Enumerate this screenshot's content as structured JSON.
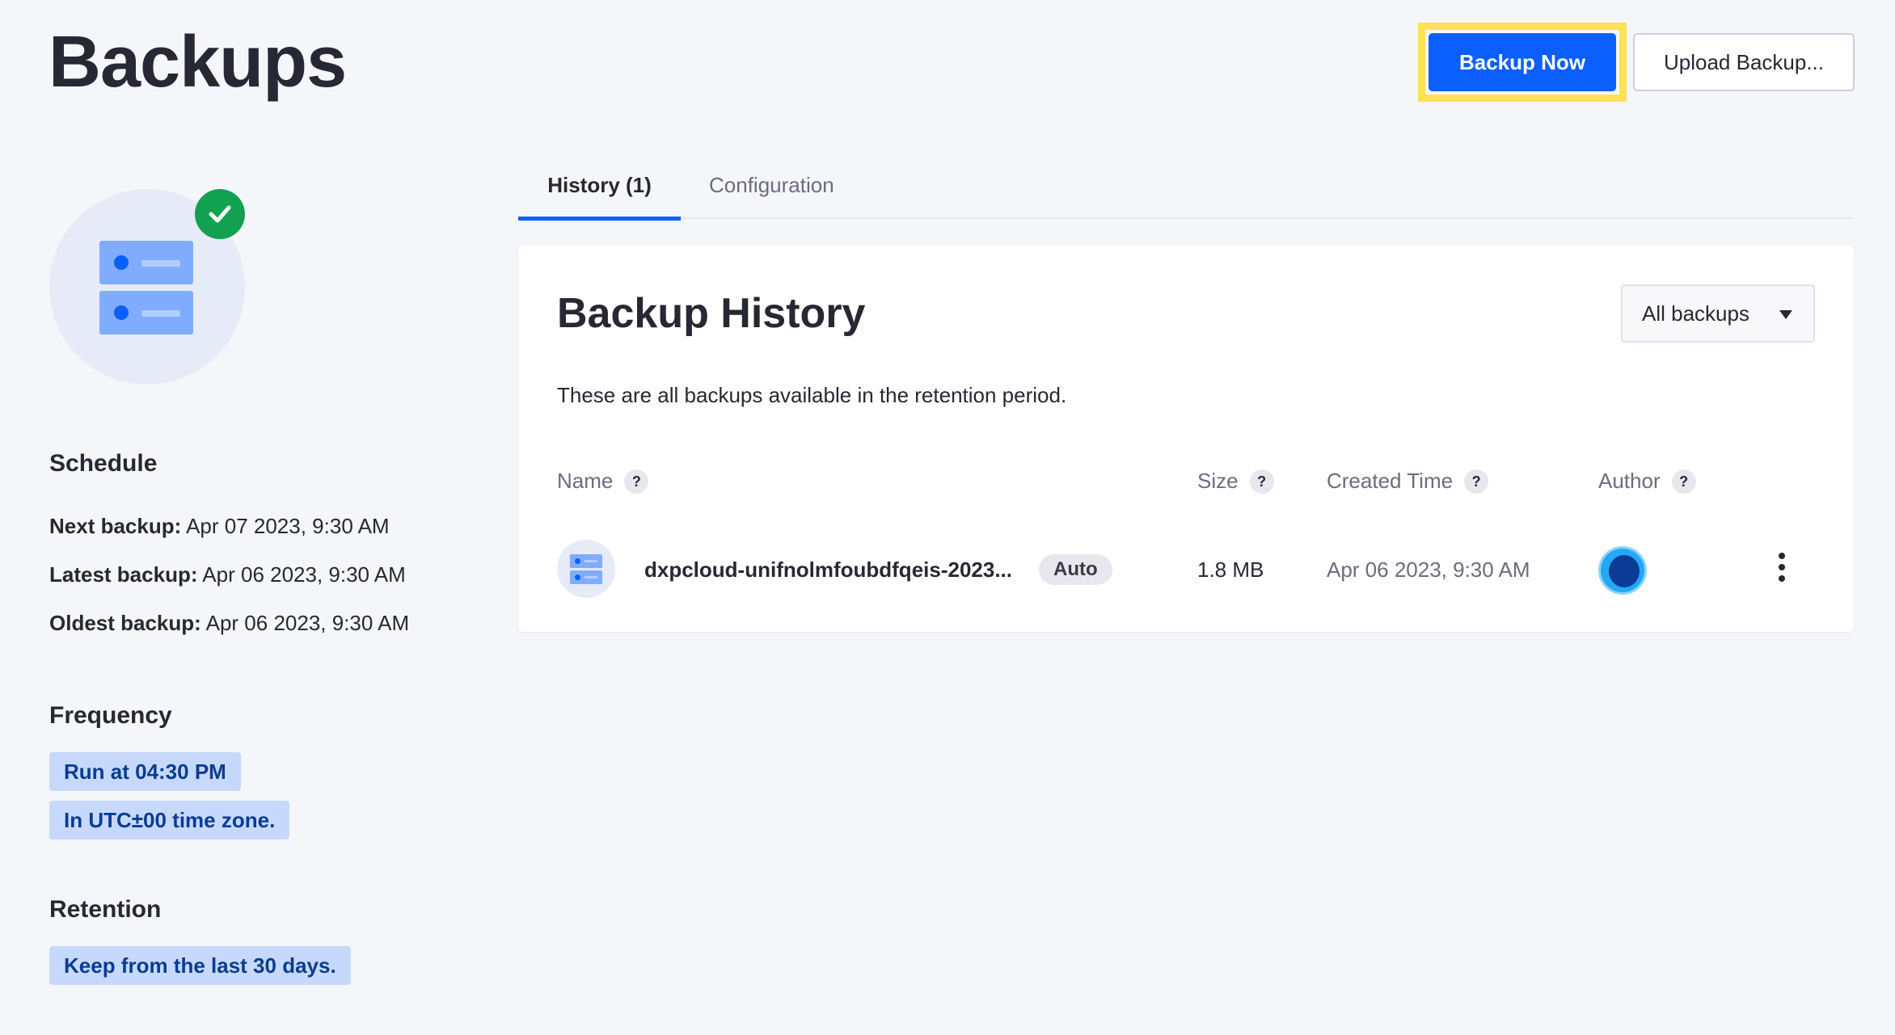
{
  "page": {
    "title": "Backups"
  },
  "header": {
    "backup_now_label": "Backup Now",
    "upload_label": "Upload Backup..."
  },
  "sidebar": {
    "schedule": {
      "title": "Schedule",
      "next_label": "Next backup:",
      "next_value": "Apr 07 2023, 9:30 AM",
      "latest_label": "Latest backup:",
      "latest_value": "Apr 06 2023, 9:30 AM",
      "oldest_label": "Oldest backup:",
      "oldest_value": "Apr 06 2023, 9:30 AM"
    },
    "frequency": {
      "title": "Frequency",
      "run_at": "Run at 04:30 PM",
      "timezone": "In UTC±00 time zone."
    },
    "retention": {
      "title": "Retention",
      "keep": "Keep from the last 30 days."
    }
  },
  "tabs": [
    {
      "label": "History (1)",
      "active": true
    },
    {
      "label": "Configuration",
      "active": false
    }
  ],
  "history": {
    "title": "Backup History",
    "filter_value": "All backups",
    "description": "These are all backups available in the retention period.",
    "columns": {
      "name": "Name",
      "size": "Size",
      "created": "Created Time",
      "author": "Author",
      "help": "?"
    },
    "rows": [
      {
        "name": "dxpcloud-unifnolmfoubdfqeis-2023...",
        "badge": "Auto",
        "size": "1.8 MB",
        "created": "Apr 06 2023, 9:30 AM"
      }
    ]
  },
  "colors": {
    "primary": "#0b5fff",
    "success": "#12a150",
    "highlight": "#fce254",
    "chip_bg": "#c6d9fc"
  }
}
